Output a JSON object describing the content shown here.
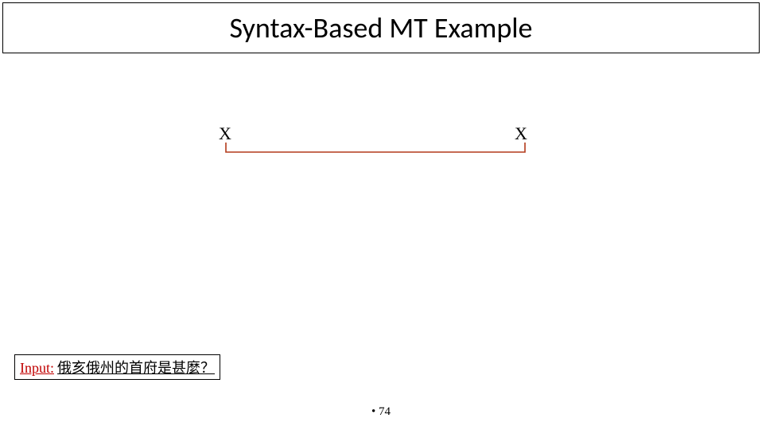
{
  "title": "Syntax-Based MT Example",
  "diagram": {
    "left_label": "X",
    "right_label": "X"
  },
  "input": {
    "label": "Input:",
    "value": "俄亥俄州的首府是甚麼？"
  },
  "page_bullet": "•",
  "page_number": "74"
}
